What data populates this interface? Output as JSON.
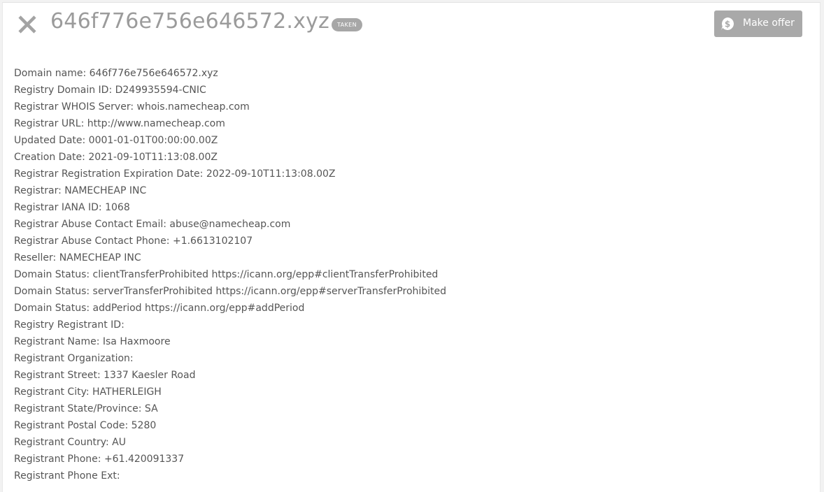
{
  "header": {
    "domain": "646f776e756e646572.xyz",
    "status_badge": "TAKEN",
    "offer_label": "Make offer",
    "close_icon": "close-icon",
    "offer_icon": "dollar-circle-icon"
  },
  "colors": {
    "title": "#9b9b9b",
    "badge_bg": "#a7a7a7",
    "button_bg": "#a9a9a9",
    "body_text": "#555555"
  },
  "whois_lines": [
    "Domain name: 646f776e756e646572.xyz",
    "Registry Domain ID: D249935594-CNIC",
    "Registrar WHOIS Server: whois.namecheap.com",
    "Registrar URL: http://www.namecheap.com",
    "Updated Date: 0001-01-01T00:00:00.00Z",
    "Creation Date: 2021-09-10T11:13:08.00Z",
    "Registrar Registration Expiration Date: 2022-09-10T11:13:08.00Z",
    "Registrar: NAMECHEAP INC",
    "Registrar IANA ID: 1068",
    "Registrar Abuse Contact Email: abuse@namecheap.com",
    "Registrar Abuse Contact Phone: +1.6613102107",
    "Reseller: NAMECHEAP INC",
    "Domain Status: clientTransferProhibited https://icann.org/epp#clientTransferProhibited",
    "Domain Status: serverTransferProhibited https://icann.org/epp#serverTransferProhibited",
    "Domain Status: addPeriod https://icann.org/epp#addPeriod",
    "Registry Registrant ID:",
    "Registrant Name: Isa Haxmoore",
    "Registrant Organization:",
    "Registrant Street: 1337 Kaesler Road",
    "Registrant City: HATHERLEIGH",
    "Registrant State/Province: SA",
    "Registrant Postal Code: 5280",
    "Registrant Country: AU",
    "Registrant Phone: +61.420091337",
    "Registrant Phone Ext:"
  ]
}
